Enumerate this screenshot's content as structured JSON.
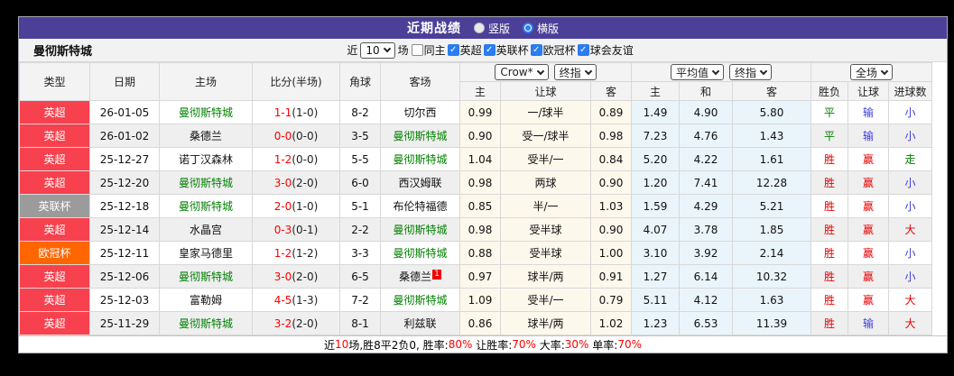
{
  "title_bar": {
    "title": "近期战绩",
    "radios": [
      {
        "label": "竖版",
        "checked": false
      },
      {
        "label": "横版",
        "checked": true
      }
    ]
  },
  "filter_bar": {
    "team": "曼彻斯特城",
    "near_label": "近",
    "matches_select": "10",
    "matches_label": "场",
    "checkboxes": [
      {
        "label": "同主",
        "checked": false
      },
      {
        "label": "英超",
        "checked": true
      },
      {
        "label": "英联杯",
        "checked": true
      },
      {
        "label": "欧冠杯",
        "checked": true
      },
      {
        "label": "球会友谊",
        "checked": true
      }
    ]
  },
  "table": {
    "left_headers": [
      "类型",
      "日期",
      "主场",
      "比分(半场)",
      "角球",
      "客场"
    ],
    "selects": {
      "bookmaker": "Crow*",
      "bookmaker_stage": "终指",
      "average": "平均值",
      "average_stage": "终指",
      "scope": "全场"
    },
    "sub_headers": [
      "主",
      "让球",
      "客",
      "主",
      "和",
      "客",
      "胜负",
      "让球",
      "进球数"
    ],
    "league_colors": {
      "英超": "#f8414e",
      "英联杯": "#9b9b9b",
      "欧冠杯": "#ff6600"
    },
    "result_colors": {
      "胜": "#e60000",
      "平": "#008000",
      "负": "#3c3cd9",
      "赢": "#e60000",
      "输": "#3c3cd9",
      "走": "#008000",
      "大": "#e60000",
      "小": "#3c3cd9"
    },
    "highlight_team": "曼彻斯特城",
    "highlight_color": "#008000",
    "rows": [
      {
        "type": "英超",
        "date": "26-01-05",
        "home": "曼彻斯特城",
        "score": "1-1",
        "half": "(1-0)",
        "corner": "8-2",
        "away": "切尔西",
        "odds_home": "0.99",
        "handicap": "一/球半",
        "odds_away": "0.89",
        "avg_home": "1.49",
        "avg_draw": "4.90",
        "avg_away": "5.80",
        "result": "平",
        "handicap_result": "输",
        "goals": "小"
      },
      {
        "type": "英超",
        "date": "26-01-02",
        "home": "桑德兰",
        "score": "0-0",
        "half": "(0-0)",
        "corner": "3-5",
        "away": "曼彻斯特城",
        "odds_home": "0.90",
        "handicap": "受一/球半",
        "odds_away": "0.98",
        "avg_home": "7.23",
        "avg_draw": "4.76",
        "avg_away": "1.43",
        "result": "平",
        "handicap_result": "输",
        "goals": "小"
      },
      {
        "type": "英超",
        "date": "25-12-27",
        "home": "诺丁汉森林",
        "score": "1-2",
        "half": "(0-0)",
        "corner": "5-5",
        "away": "曼彻斯特城",
        "odds_home": "1.04",
        "handicap": "受半/一",
        "odds_away": "0.84",
        "avg_home": "5.20",
        "avg_draw": "4.22",
        "avg_away": "1.61",
        "result": "胜",
        "handicap_result": "赢",
        "goals": "走"
      },
      {
        "type": "英超",
        "date": "25-12-20",
        "home": "曼彻斯特城",
        "score": "3-0",
        "half": "(2-0)",
        "corner": "6-0",
        "away": "西汉姆联",
        "odds_home": "0.98",
        "handicap": "两球",
        "odds_away": "0.90",
        "avg_home": "1.20",
        "avg_draw": "7.41",
        "avg_away": "12.28",
        "result": "胜",
        "handicap_result": "赢",
        "goals": "小"
      },
      {
        "type": "英联杯",
        "date": "25-12-18",
        "home": "曼彻斯特城",
        "score": "2-0",
        "half": "(1-0)",
        "corner": "5-1",
        "away": "布伦特福德",
        "odds_home": "0.85",
        "handicap": "半/一",
        "odds_away": "1.03",
        "avg_home": "1.59",
        "avg_draw": "4.29",
        "avg_away": "5.21",
        "result": "胜",
        "handicap_result": "赢",
        "goals": "小"
      },
      {
        "type": "英超",
        "date": "25-12-14",
        "home": "水晶宫",
        "score": "0-3",
        "half": "(0-1)",
        "corner": "2-2",
        "away": "曼彻斯特城",
        "odds_home": "0.98",
        "handicap": "受半球",
        "odds_away": "0.90",
        "avg_home": "4.07",
        "avg_draw": "3.78",
        "avg_away": "1.85",
        "result": "胜",
        "handicap_result": "赢",
        "goals": "大"
      },
      {
        "type": "欧冠杯",
        "date": "25-12-11",
        "home": "皇家马德里",
        "score": "1-2",
        "half": "(1-2)",
        "corner": "3-3",
        "away": "曼彻斯特城",
        "odds_home": "0.88",
        "handicap": "受半球",
        "odds_away": "1.00",
        "avg_home": "3.10",
        "avg_draw": "3.92",
        "avg_away": "2.14",
        "result": "胜",
        "handicap_result": "赢",
        "goals": "小"
      },
      {
        "type": "英超",
        "date": "25-12-06",
        "home": "曼彻斯特城",
        "score": "3-0",
        "half": "(2-0)",
        "corner": "6-5",
        "away": "桑德兰",
        "away_rank": "1",
        "odds_home": "0.97",
        "handicap": "球半/两",
        "odds_away": "0.91",
        "avg_home": "1.27",
        "avg_draw": "6.14",
        "avg_away": "10.32",
        "result": "胜",
        "handicap_result": "赢",
        "goals": "小"
      },
      {
        "type": "英超",
        "date": "25-12-03",
        "home": "富勒姆",
        "score": "4-5",
        "half": "(1-3)",
        "corner": "7-2",
        "away": "曼彻斯特城",
        "odds_home": "1.09",
        "handicap": "受半/一",
        "odds_away": "0.79",
        "avg_home": "5.11",
        "avg_draw": "4.12",
        "avg_away": "1.63",
        "result": "胜",
        "handicap_result": "赢",
        "goals": "大"
      },
      {
        "type": "英超",
        "date": "25-11-29",
        "home": "曼彻斯特城",
        "score": "3-2",
        "half": "(2-0)",
        "corner": "8-1",
        "away": "利兹联",
        "odds_home": "0.86",
        "handicap": "球半/两",
        "odds_away": "1.02",
        "avg_home": "1.23",
        "avg_draw": "6.53",
        "avg_away": "11.39",
        "result": "胜",
        "handicap_result": "输",
        "goals": "大"
      }
    ]
  },
  "summary": {
    "segments": [
      {
        "text": "近",
        "color": "#000000"
      },
      {
        "text": "10",
        "color": "#ff0000"
      },
      {
        "text": "场,胜8平2负0, 胜率:",
        "color": "#000000"
      },
      {
        "text": "80%",
        "color": "#ff0000"
      },
      {
        "text": " 让胜率:",
        "color": "#000000"
      },
      {
        "text": "70%",
        "color": "#ff0000"
      },
      {
        "text": " 大率:",
        "color": "#000000"
      },
      {
        "text": "30%",
        "color": "#ff0000"
      },
      {
        "text": " 单率:",
        "color": "#000000"
      },
      {
        "text": "70%",
        "color": "#ff0000"
      }
    ]
  },
  "colors": {
    "header_purple": "#4b3f98",
    "accent_blue": "#2b7cf0",
    "cream_bg": "#fdf8ec",
    "lightblue_bg": "#eaf4fb"
  }
}
